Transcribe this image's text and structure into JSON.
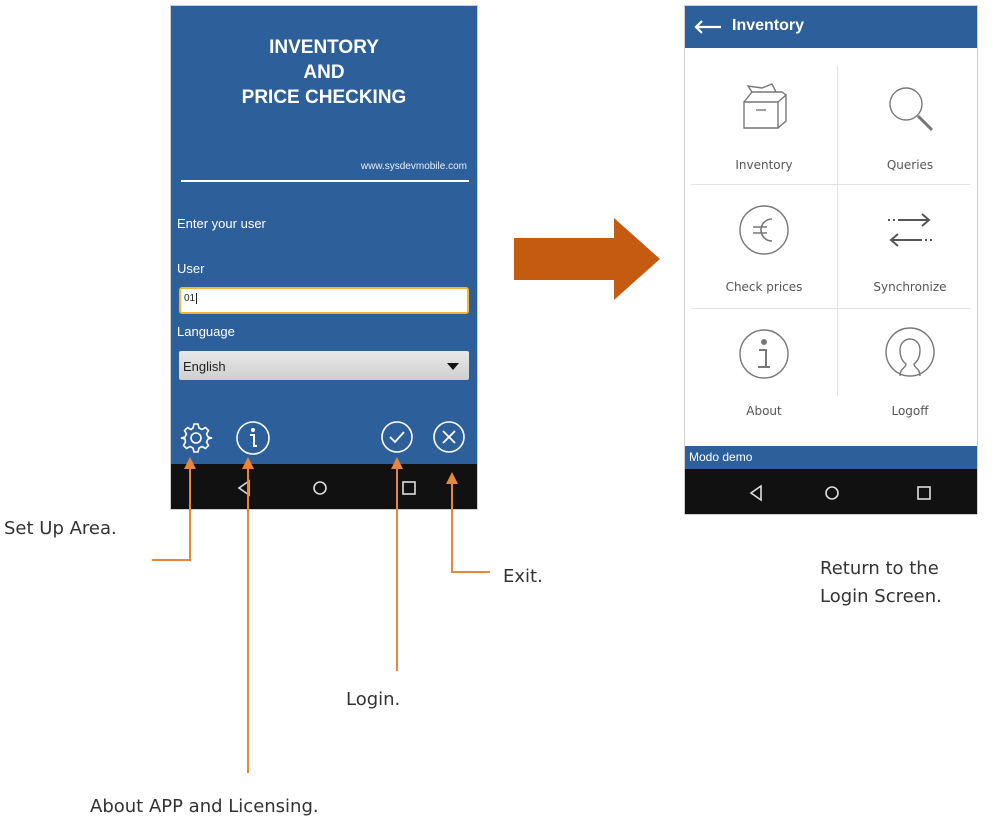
{
  "login": {
    "title_line1": "INVENTORY",
    "title_line2": "AND",
    "title_line3": "PRICE CHECKING",
    "website": "www.sysdevmobile.com",
    "prompt": "Enter your user",
    "user_label": "User",
    "user_value": "01",
    "language_label": "Language",
    "language_value": "English",
    "icons": [
      "gear-icon",
      "info-icon",
      "check-circle-icon",
      "close-circle-icon"
    ]
  },
  "menu": {
    "title": "Inventory",
    "items": [
      {
        "label": "Inventory",
        "icon": "box-icon"
      },
      {
        "label": "Queries",
        "icon": "magnifier-icon"
      },
      {
        "label": "Check prices",
        "icon": "euro-icon"
      },
      {
        "label": "Synchronize",
        "icon": "sync-arrows-icon"
      },
      {
        "label": "About",
        "icon": "info-icon"
      },
      {
        "label": "Logoff",
        "icon": "user-icon"
      }
    ],
    "status": "Modo demo"
  },
  "navbar": {
    "icons": [
      "back-icon",
      "home-icon",
      "recents-icon"
    ]
  },
  "annotations": {
    "setup": "Set Up Area.",
    "about": "About APP and Licensing.",
    "login": "Login.",
    "exit": "Exit.",
    "return_line1": "Return to the",
    "return_line2": "Login Screen."
  },
  "colors": {
    "app_blue": "#2d5f9b",
    "annotation_orange": "#e8873a",
    "arrow_orange": "#c55a11"
  }
}
